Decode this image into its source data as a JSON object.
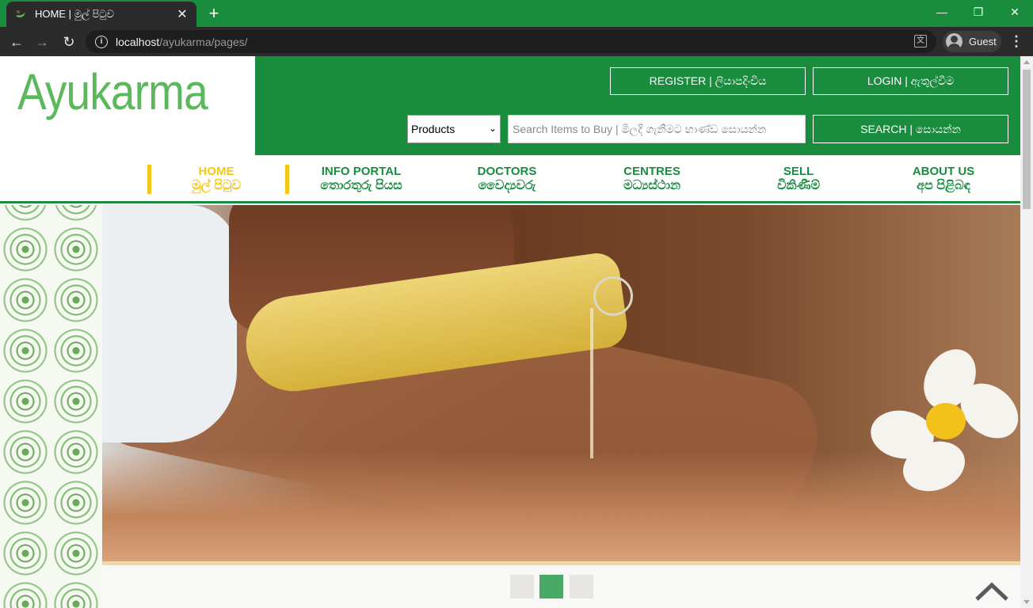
{
  "browser": {
    "tab_title": "HOME | මුල් පිටුව",
    "new_tab": "+",
    "url_host": "localhost",
    "url_path": "/ayukarma/pages/",
    "profile_label": "Guest"
  },
  "header": {
    "logo_text": "Ayukarma",
    "register_label": "REGISTER  |  ලියාපදිංචිය",
    "login_label": "LOGIN  |  ඇතුල්වීම",
    "category_selected": "Products",
    "search_placeholder": "Search Items to Buy | මිලදී ගැනීමට භාණ්ඩ සොයන්න",
    "search_label": "SEARCH  |  සොයන්න"
  },
  "nav": {
    "items": [
      {
        "en": "HOME",
        "si": "මුල් පිටුව"
      },
      {
        "en": "INFO PORTAL",
        "si": "තොරතුරු පියස"
      },
      {
        "en": "DOCTORS",
        "si": "වෛද්‍යවරු"
      },
      {
        "en": "CENTRES",
        "si": "මධ්‍යස්ථාන"
      },
      {
        "en": "SELL",
        "si": "විකිණීම්"
      },
      {
        "en": "ABOUT US",
        "si": "අප පිළිබඳ"
      }
    ]
  },
  "carousel": {
    "slide_count": 3,
    "active_index": 1
  },
  "colors": {
    "brand_green": "#1a8c3e",
    "accent_yellow": "#f5c518",
    "logo_green": "#5cb85c"
  }
}
